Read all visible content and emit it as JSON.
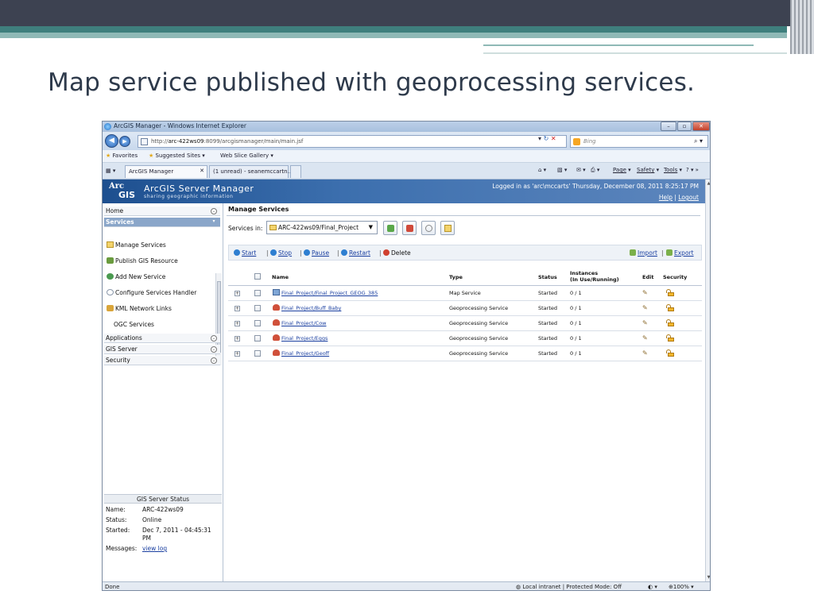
{
  "slide": {
    "title": "Map service published with geoprocessing services."
  },
  "browser": {
    "window_title": "ArcGIS Manager - Windows Internet Explorer",
    "address_prefix": "http://",
    "address_host": "arc-422ws09",
    "address_rest": ":8099/arcgismanager/main/main.jsf",
    "search_placeholder": "Bing",
    "favorites": {
      "favorites_label": "Favorites",
      "suggested_sites": "Suggested Sites ▾",
      "web_slice_gallery": "Web Slice Gallery ▾"
    },
    "tabs": [
      {
        "label": "ArcGIS Manager"
      },
      {
        "label": "(1 unread) - seanemccartn..."
      }
    ],
    "commands": {
      "page": "Page",
      "safety": "Safety",
      "tools": "Tools"
    },
    "status": {
      "left": "Done",
      "zone": "Local intranet | Protected Mode: Off",
      "zoom": "100%"
    }
  },
  "app": {
    "name": "ArcGIS Server Manager",
    "logo_arc": "Arc",
    "logo_gis": "GIS",
    "tagline": "sharing geographic information",
    "login_text": "Logged in as 'arc\\mccarts'   Thursday, December 08, 2011 8:25:17 PM",
    "help_link": "Help",
    "logout_link": "Logout",
    "link_separator": "|"
  },
  "nav": {
    "home": "Home",
    "services": "Services",
    "service_items": [
      {
        "label": "Manage Services"
      },
      {
        "label": "Publish GIS Resource"
      },
      {
        "label": "Add New Service"
      },
      {
        "label": "Configure Services Handler"
      },
      {
        "label": "KML Network Links"
      },
      {
        "label": "OGC Services"
      }
    ],
    "applications": "Applications",
    "gis_server": "GIS Server",
    "security": "Security"
  },
  "server_status": {
    "heading": "GIS Server Status",
    "name_label": "Name:",
    "name_value": "ARC-422ws09",
    "status_label": "Status:",
    "status_value": "Online",
    "started_label": "Started:",
    "started_value_1": "Dec 7, 2011 - 04:45:31",
    "started_value_2": "PM",
    "messages_label": "Messages:",
    "messages_link": "view log"
  },
  "manage": {
    "title": "Manage Services",
    "services_in_label": "Services in:",
    "services_in_value": "ARC-422ws09/Final_Project",
    "actions": {
      "start": "Start",
      "stop": "Stop",
      "pause": "Pause",
      "restart": "Restart",
      "delete": "Delete",
      "import": "Import",
      "export": "Export",
      "separator": "|"
    },
    "columns": {
      "name": "Name",
      "type": "Type",
      "status": "Status",
      "instances_1": "Instances",
      "instances_2": "(In Use/Running)",
      "edit": "Edit",
      "security": "Security"
    },
    "rows": [
      {
        "name": "Final_Project/Final_Project_GEOG_385",
        "type": "Map Service",
        "status": "Started",
        "instances": "0 / 1",
        "icon": "map-service-icon"
      },
      {
        "name": "Final_Project/Buff_Baby",
        "type": "Geoprocessing Service",
        "status": "Started",
        "instances": "0 / 1",
        "icon": "geoprocessing-service-icon"
      },
      {
        "name": "Final_Project/Cow",
        "type": "Geoprocessing Service",
        "status": "Started",
        "instances": "0 / 1",
        "icon": "geoprocessing-service-icon"
      },
      {
        "name": "Final_Project/Eggs",
        "type": "Geoprocessing Service",
        "status": "Started",
        "instances": "0 / 1",
        "icon": "geoprocessing-service-icon"
      },
      {
        "name": "Final_Project/Geoff",
        "type": "Geoprocessing Service",
        "status": "Started",
        "instances": "0 / 1",
        "icon": "geoprocessing-service-icon"
      }
    ]
  },
  "colors": {
    "header_blue": "#1d4f8f",
    "link_blue": "#1a3fa0",
    "active_nav": "#8aa6c9"
  }
}
